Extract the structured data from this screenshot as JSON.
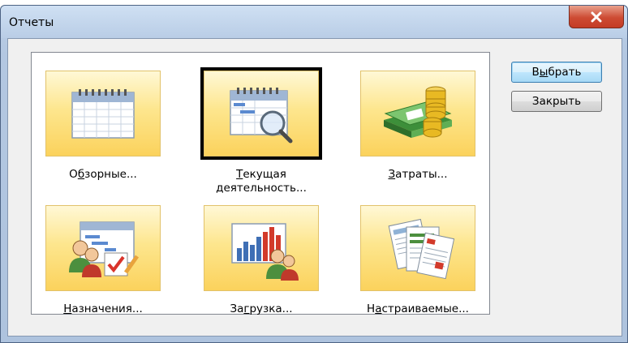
{
  "window": {
    "title": "Отчеты"
  },
  "tiles": [
    {
      "label_pre": "О",
      "label_u": "б",
      "label_post": "зорные...",
      "label_line2": "",
      "icon": "calendar-icon",
      "selected": false
    },
    {
      "label_pre": "",
      "label_u": "Т",
      "label_post": "екущая",
      "label_line2": "деятельность...",
      "icon": "calendar-magnifier-icon",
      "selected": true
    },
    {
      "label_pre": "",
      "label_u": "З",
      "label_post": "атраты...",
      "label_line2": "",
      "icon": "money-icon",
      "selected": false
    },
    {
      "label_pre": "",
      "label_u": "Н",
      "label_post": "азначения...",
      "label_line2": "",
      "icon": "assignment-people-icon",
      "selected": false
    },
    {
      "label_pre": "За",
      "label_u": "г",
      "label_post": "рузка...",
      "label_line2": "",
      "icon": "workload-chart-icon",
      "selected": false
    },
    {
      "label_pre": "Н",
      "label_u": "а",
      "label_post": "страиваемые...",
      "label_line2": "",
      "icon": "custom-reports-icon",
      "selected": false
    }
  ],
  "buttons": {
    "select": {
      "pre": "В",
      "u": "ы",
      "post": "брать"
    },
    "close": {
      "pre": "",
      "u": "",
      "post": "Закрыть"
    }
  },
  "colors": {
    "tile_gradient_top": "#fff8d6",
    "tile_gradient_bottom": "#fbd25c",
    "close_button": "#cd4b33",
    "title_bar": "#b9cde6"
  }
}
